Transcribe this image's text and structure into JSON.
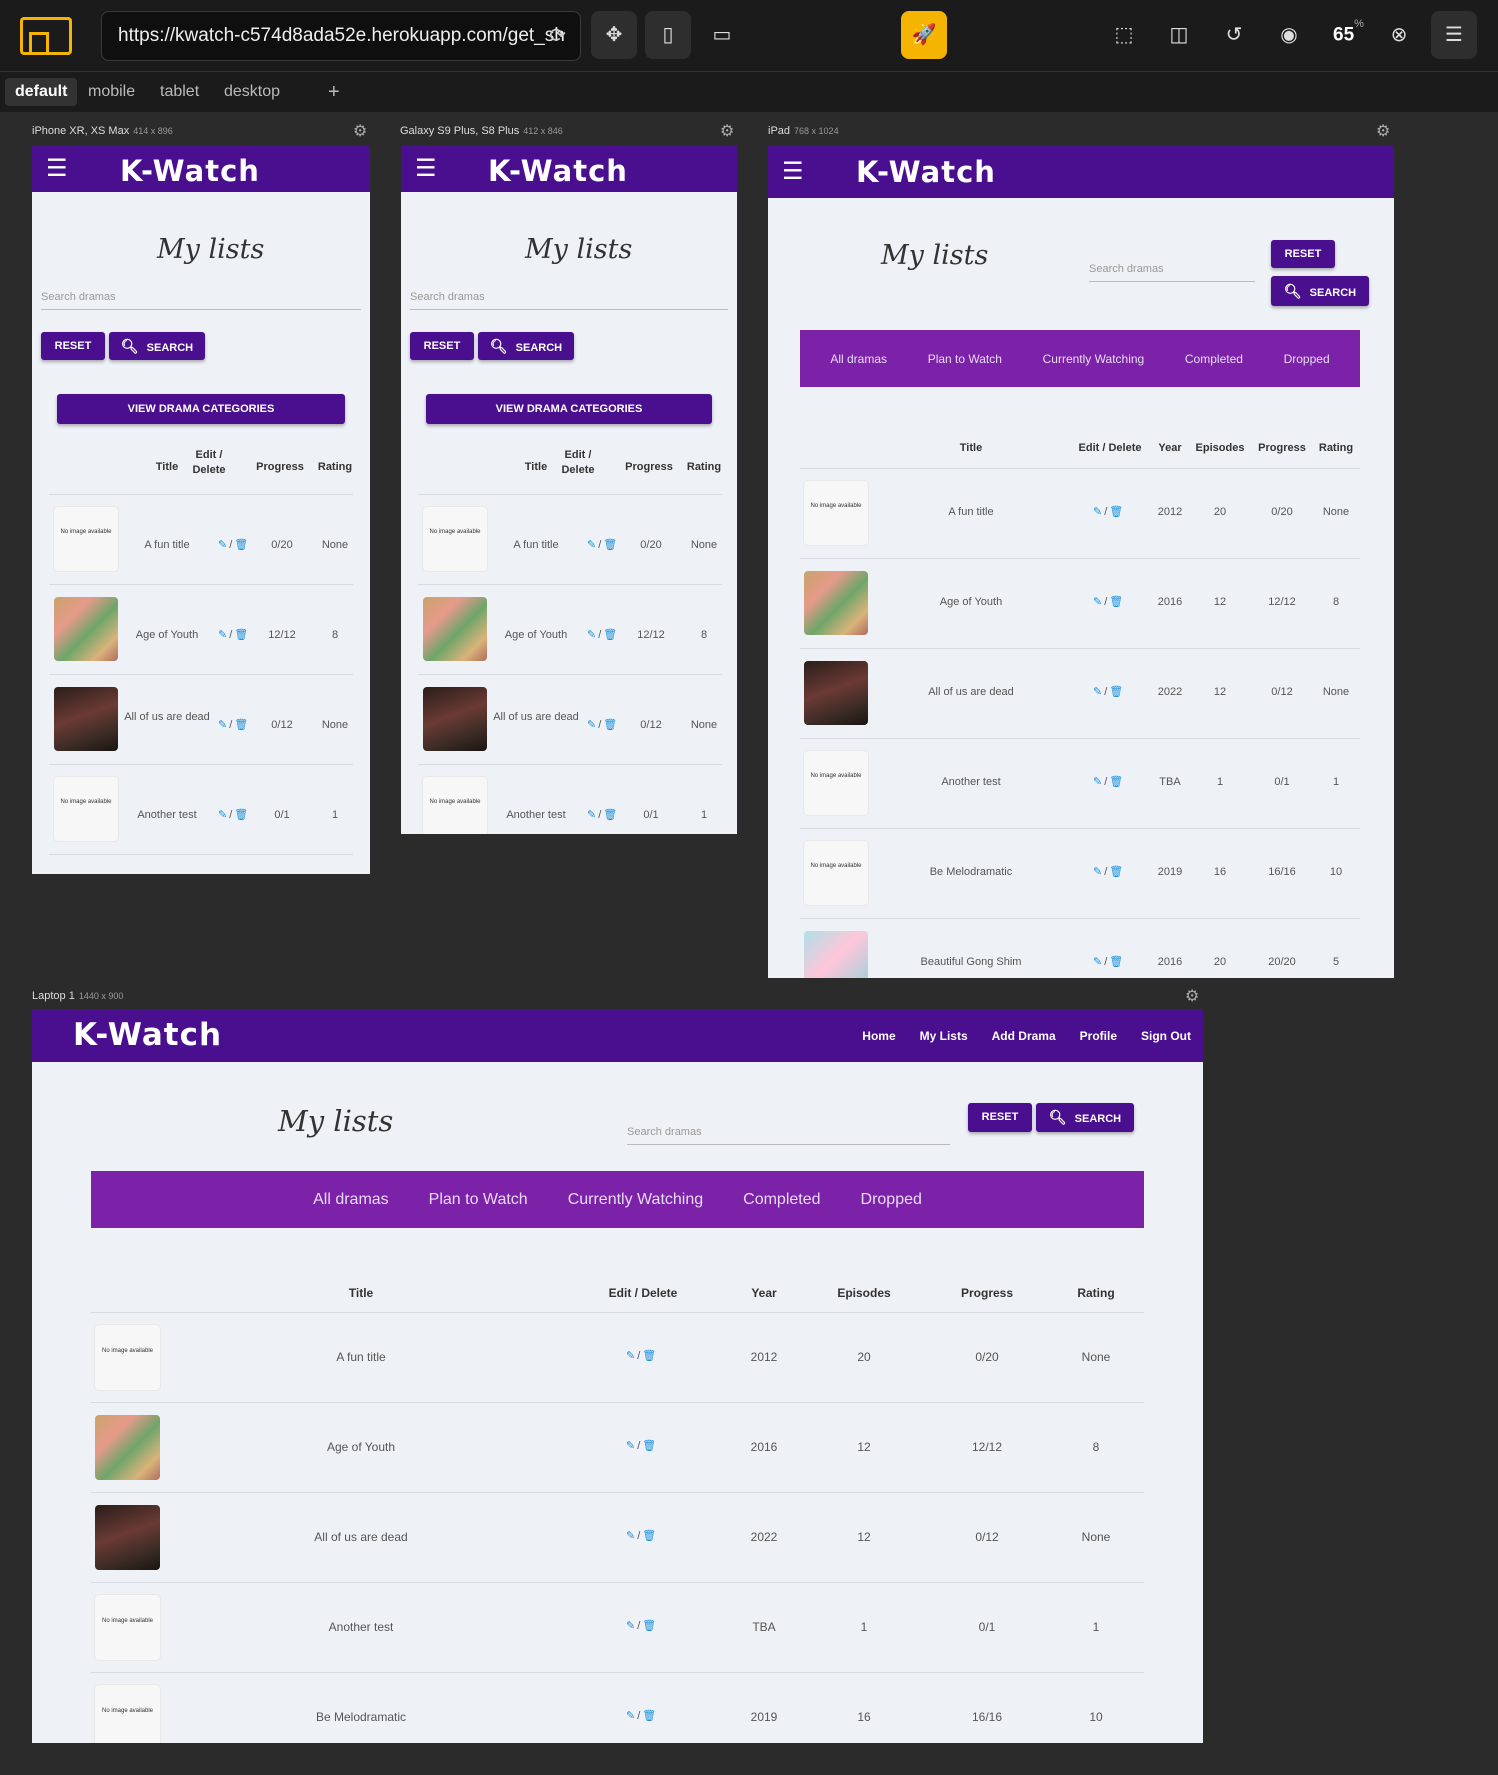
{
  "toolbar": {
    "url": "https://kwatch-c574d8ada52e.herokuapp.com/get_sh",
    "zoom": "65",
    "zoom_unit": "%"
  },
  "device_tabs": [
    "default",
    "mobile",
    "tablet",
    "desktop"
  ],
  "add_tab": "+",
  "app": {
    "brand": "K-Watch",
    "page_title": "My lists",
    "search_placeholder": "Search dramas",
    "reset_label": "RESET",
    "search_label": "SEARCH",
    "view_categories_label": "VIEW DRAMA CATEGORIES",
    "nav_links": [
      "Home",
      "My Lists",
      "Add Drama",
      "Profile",
      "Sign Out"
    ],
    "categories": [
      "All dramas",
      "Plan to Watch",
      "Currently Watching",
      "Completed",
      "Dropped"
    ],
    "no_image_text": "No image available",
    "edit_sep": "/",
    "columns_mobile": [
      "Title",
      "Edit / Delete",
      "Progress",
      "Rating"
    ],
    "columns_full": [
      "Title",
      "Edit / Delete",
      "Year",
      "Episodes",
      "Progress",
      "Rating"
    ],
    "dramas": [
      {
        "title": "A fun title",
        "year": "2012",
        "episodes": "20",
        "progress": "0/20",
        "rating": "None",
        "poster": "none"
      },
      {
        "title": "Age of Youth",
        "year": "2016",
        "episodes": "12",
        "progress": "12/12",
        "rating": "8",
        "poster": "youth"
      },
      {
        "title": "All of us are dead",
        "year": "2022",
        "episodes": "12",
        "progress": "0/12",
        "rating": "None",
        "poster": "dead"
      },
      {
        "title": "Another test",
        "year": "TBA",
        "episodes": "1",
        "progress": "0/1",
        "rating": "1",
        "poster": "none"
      },
      {
        "title": "Be Melodramatic",
        "year": "2019",
        "episodes": "16",
        "progress": "16/16",
        "rating": "10",
        "poster": "none"
      },
      {
        "title": "Beautiful Gong Shim",
        "year": "2016",
        "episodes": "20",
        "progress": "20/20",
        "rating": "5",
        "poster": "gong"
      }
    ]
  },
  "devices": [
    {
      "name": "iPhone XR, XS Max",
      "size": "414 x 896"
    },
    {
      "name": "Galaxy S9 Plus, S8 Plus",
      "size": "412 x 846"
    },
    {
      "name": "iPad",
      "size": "768 x 1024"
    },
    {
      "name": "Laptop 1",
      "size": "1440 x 900"
    }
  ],
  "colors": {
    "nav": "#4a0f8f",
    "category_bar": "#7b22a8",
    "edit_icon": "#1a90d9"
  }
}
